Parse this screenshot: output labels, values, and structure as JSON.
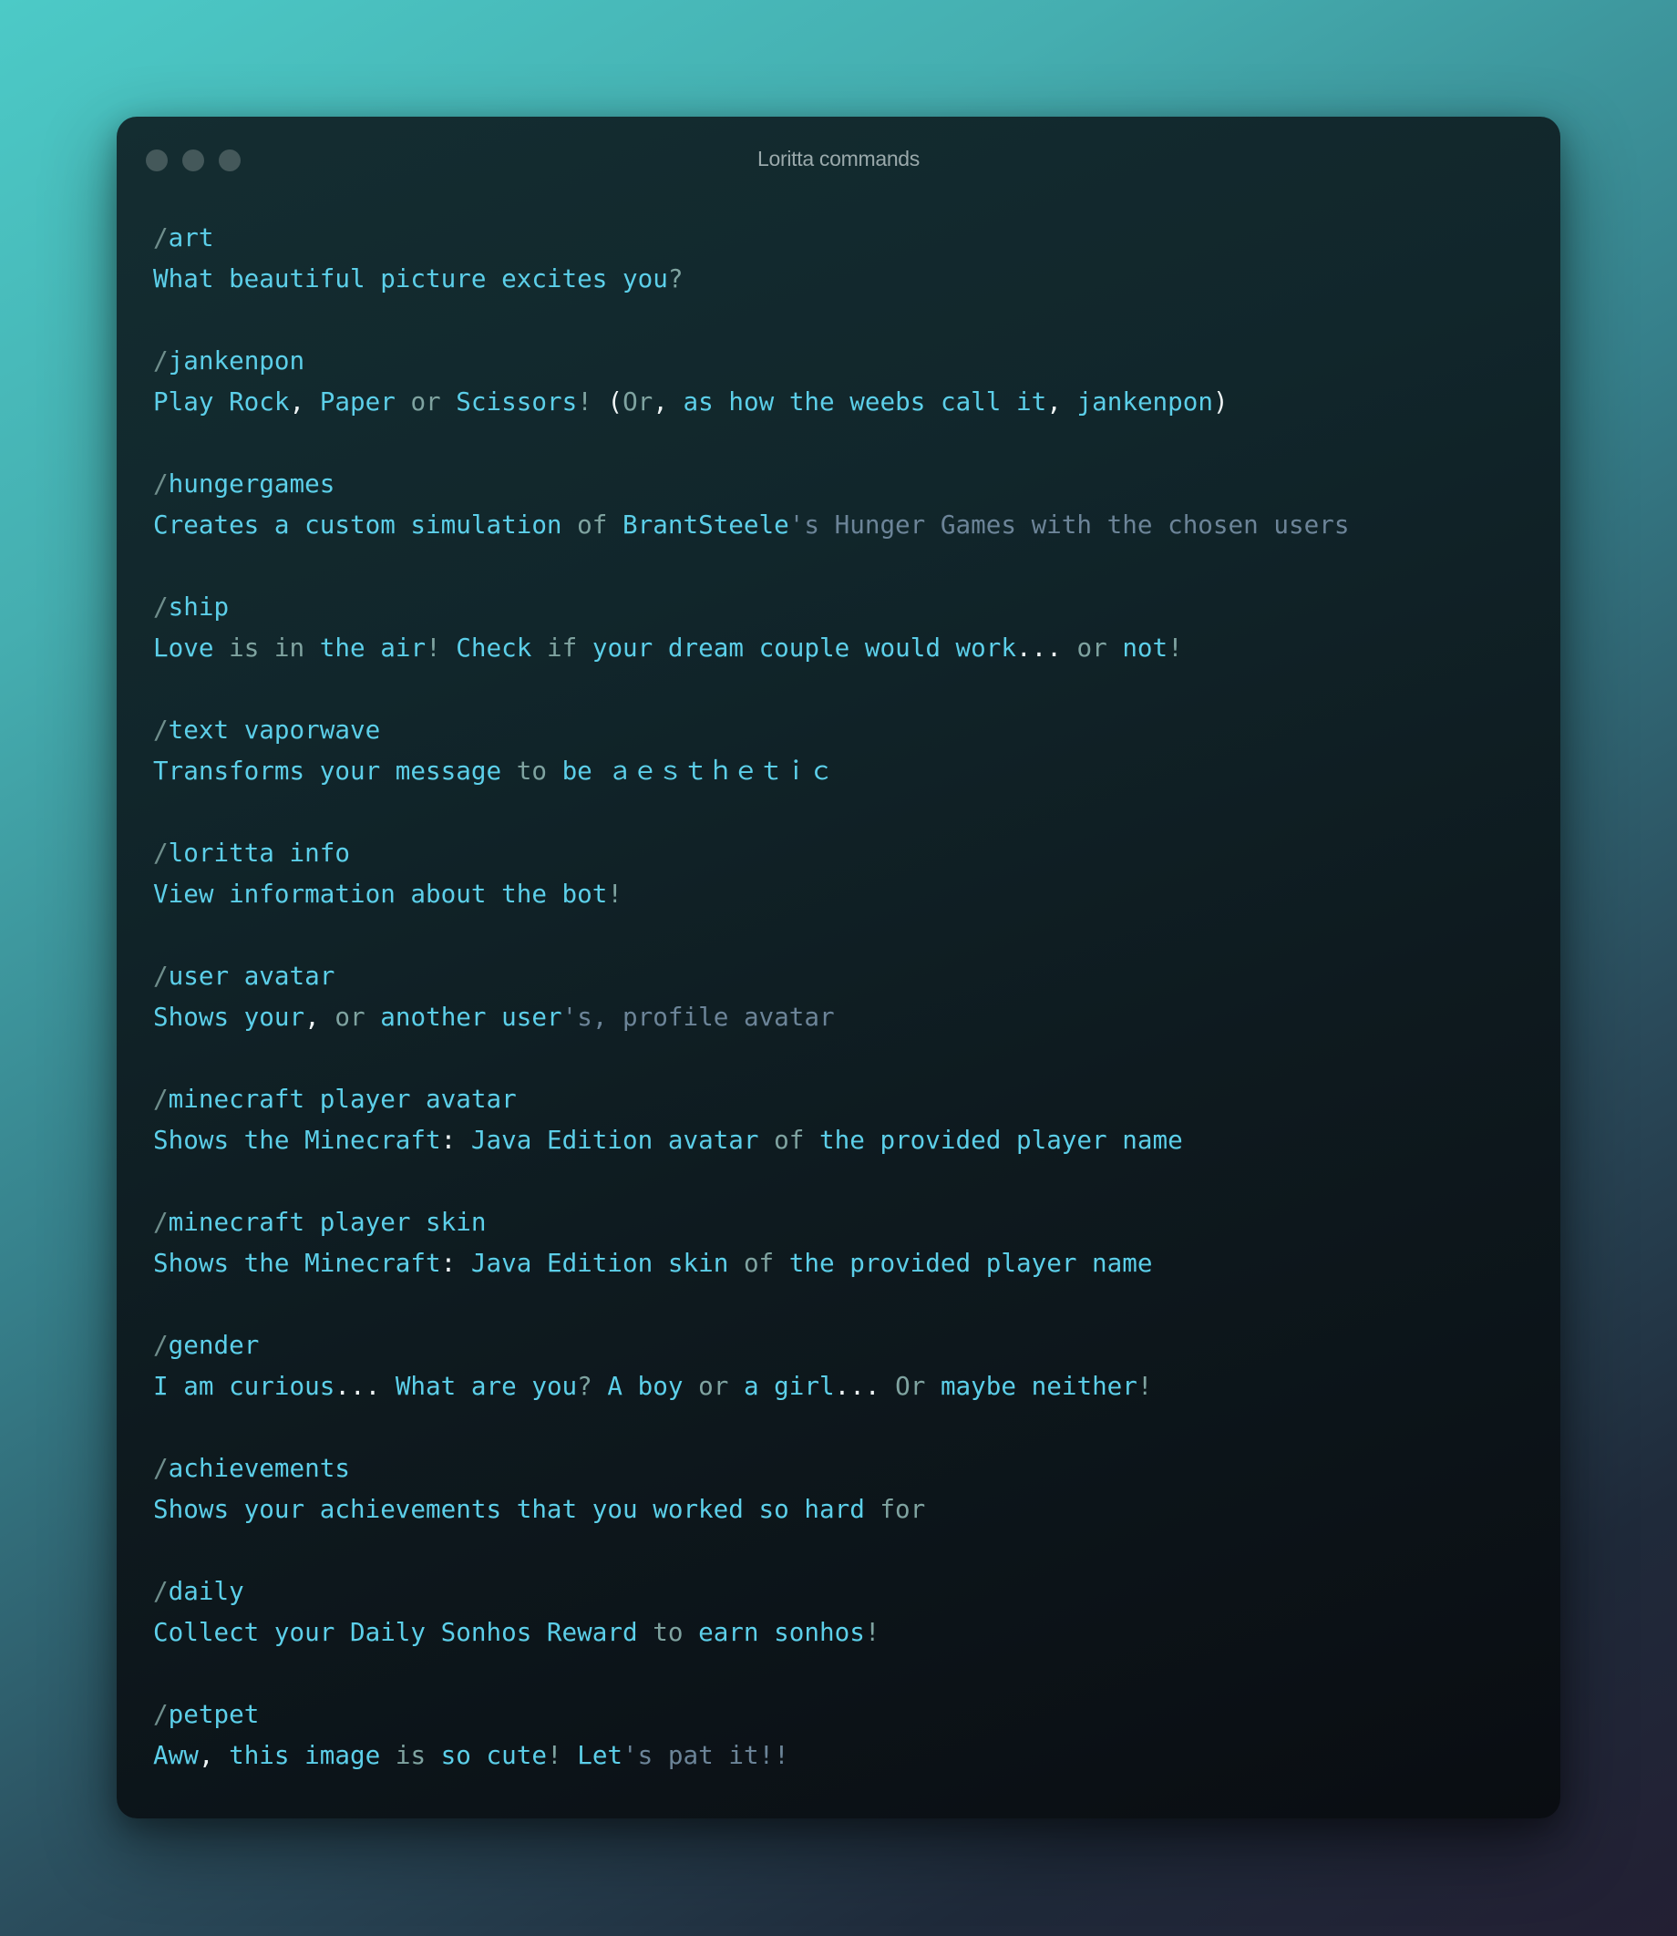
{
  "window": {
    "title": "Loritta commands",
    "controls": [
      "close",
      "minimize",
      "maximize"
    ]
  },
  "colors": {
    "command": "#5ccfe9",
    "slash": "#6f8e8c",
    "word": "#5ccfe9",
    "keyword": "#7fa3a0",
    "punctuation": "#eef3f4",
    "string": "#6c8498"
  },
  "commands": [
    {
      "slash": "/",
      "name": "art",
      "description": [
        {
          "t": "word",
          "v": "What beautiful picture excites you"
        },
        {
          "t": "kw",
          "v": "?"
        }
      ]
    },
    {
      "slash": "/",
      "name": "jankenpon",
      "description": [
        {
          "t": "word",
          "v": "Play Rock"
        },
        {
          "t": "punct",
          "v": ","
        },
        {
          "t": "word",
          "v": " Paper "
        },
        {
          "t": "kw",
          "v": "or"
        },
        {
          "t": "word",
          "v": " Scissors"
        },
        {
          "t": "kw",
          "v": "!"
        },
        {
          "t": "word",
          "v": " "
        },
        {
          "t": "punct",
          "v": "("
        },
        {
          "t": "kw",
          "v": "Or"
        },
        {
          "t": "punct",
          "v": ","
        },
        {
          "t": "word",
          "v": " as how the weebs call it"
        },
        {
          "t": "punct",
          "v": ","
        },
        {
          "t": "word",
          "v": " jankenpon"
        },
        {
          "t": "punct",
          "v": ")"
        }
      ]
    },
    {
      "slash": "/",
      "name": "hungergames",
      "description": [
        {
          "t": "word",
          "v": "Creates a custom simulation "
        },
        {
          "t": "kw",
          "v": "of"
        },
        {
          "t": "word",
          "v": " BrantSteele"
        },
        {
          "t": "str",
          "v": "'s Hunger Games with the chosen users"
        }
      ]
    },
    {
      "slash": "/",
      "name": "ship",
      "description": [
        {
          "t": "word",
          "v": "Love "
        },
        {
          "t": "kw",
          "v": "is in"
        },
        {
          "t": "word",
          "v": " the air"
        },
        {
          "t": "kw",
          "v": "!"
        },
        {
          "t": "word",
          "v": " Check "
        },
        {
          "t": "kw",
          "v": "if"
        },
        {
          "t": "word",
          "v": " your dream couple would work"
        },
        {
          "t": "punct",
          "v": "..."
        },
        {
          "t": "word",
          "v": " "
        },
        {
          "t": "kw",
          "v": "or"
        },
        {
          "t": "word",
          "v": " not"
        },
        {
          "t": "kw",
          "v": "!"
        }
      ]
    },
    {
      "slash": "/",
      "name": "text vaporwave",
      "description": [
        {
          "t": "word",
          "v": "Transforms your message "
        },
        {
          "t": "kw",
          "v": "to"
        },
        {
          "t": "word",
          "v": " be ａｅｓｔｈｅｔｉｃ"
        }
      ]
    },
    {
      "slash": "/",
      "name": "loritta info",
      "description": [
        {
          "t": "word",
          "v": "View information about the bot"
        },
        {
          "t": "kw",
          "v": "!"
        }
      ]
    },
    {
      "slash": "/",
      "name": "user avatar",
      "description": [
        {
          "t": "word",
          "v": "Shows your"
        },
        {
          "t": "punct",
          "v": ","
        },
        {
          "t": "word",
          "v": " "
        },
        {
          "t": "kw",
          "v": "or"
        },
        {
          "t": "word",
          "v": " another user"
        },
        {
          "t": "str",
          "v": "'s, profile avatar"
        }
      ]
    },
    {
      "slash": "/",
      "name": "minecraft player avatar",
      "description": [
        {
          "t": "word",
          "v": "Shows the Minecraft"
        },
        {
          "t": "punct",
          "v": ":"
        },
        {
          "t": "word",
          "v": " Java Edition avatar "
        },
        {
          "t": "kw",
          "v": "of"
        },
        {
          "t": "word",
          "v": " the provided player name"
        }
      ]
    },
    {
      "slash": "/",
      "name": "minecraft player skin",
      "description": [
        {
          "t": "word",
          "v": "Shows the Minecraft"
        },
        {
          "t": "punct",
          "v": ":"
        },
        {
          "t": "word",
          "v": " Java Edition skin "
        },
        {
          "t": "kw",
          "v": "of"
        },
        {
          "t": "word",
          "v": " the provided player name"
        }
      ]
    },
    {
      "slash": "/",
      "name": "gender",
      "description": [
        {
          "t": "word",
          "v": "I am curious"
        },
        {
          "t": "punct",
          "v": "..."
        },
        {
          "t": "word",
          "v": " What are you"
        },
        {
          "t": "kw",
          "v": "?"
        },
        {
          "t": "word",
          "v": " A boy "
        },
        {
          "t": "kw",
          "v": "or"
        },
        {
          "t": "word",
          "v": " a girl"
        },
        {
          "t": "punct",
          "v": "..."
        },
        {
          "t": "word",
          "v": " "
        },
        {
          "t": "kw",
          "v": "Or"
        },
        {
          "t": "word",
          "v": " maybe neither"
        },
        {
          "t": "kw",
          "v": "!"
        }
      ]
    },
    {
      "slash": "/",
      "name": "achievements",
      "description": [
        {
          "t": "word",
          "v": "Shows your achievements that you worked so hard "
        },
        {
          "t": "kw",
          "v": "for"
        }
      ]
    },
    {
      "slash": "/",
      "name": "daily",
      "description": [
        {
          "t": "word",
          "v": "Collect your Daily Sonhos Reward "
        },
        {
          "t": "kw",
          "v": "to"
        },
        {
          "t": "word",
          "v": " earn sonhos"
        },
        {
          "t": "kw",
          "v": "!"
        }
      ]
    },
    {
      "slash": "/",
      "name": "petpet",
      "description": [
        {
          "t": "word",
          "v": "Aww"
        },
        {
          "t": "punct",
          "v": ","
        },
        {
          "t": "word",
          "v": " this image "
        },
        {
          "t": "kw",
          "v": "is"
        },
        {
          "t": "word",
          "v": " so cute"
        },
        {
          "t": "kw",
          "v": "!"
        },
        {
          "t": "word",
          "v": " Let"
        },
        {
          "t": "str",
          "v": "'s pat it!!"
        }
      ]
    }
  ]
}
